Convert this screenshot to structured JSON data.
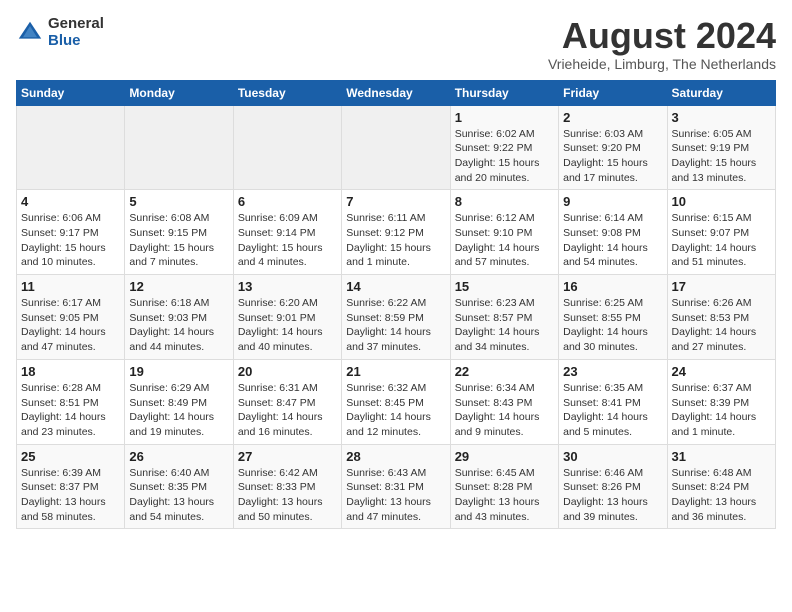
{
  "logo": {
    "general": "General",
    "blue": "Blue"
  },
  "title": "August 2024",
  "subtitle": "Vrieheide, Limburg, The Netherlands",
  "days_of_week": [
    "Sunday",
    "Monday",
    "Tuesday",
    "Wednesday",
    "Thursday",
    "Friday",
    "Saturday"
  ],
  "weeks": [
    [
      {
        "day": "",
        "info": ""
      },
      {
        "day": "",
        "info": ""
      },
      {
        "day": "",
        "info": ""
      },
      {
        "day": "",
        "info": ""
      },
      {
        "day": "1",
        "info": "Sunrise: 6:02 AM\nSunset: 9:22 PM\nDaylight: 15 hours\nand 20 minutes."
      },
      {
        "day": "2",
        "info": "Sunrise: 6:03 AM\nSunset: 9:20 PM\nDaylight: 15 hours\nand 17 minutes."
      },
      {
        "day": "3",
        "info": "Sunrise: 6:05 AM\nSunset: 9:19 PM\nDaylight: 15 hours\nand 13 minutes."
      }
    ],
    [
      {
        "day": "4",
        "info": "Sunrise: 6:06 AM\nSunset: 9:17 PM\nDaylight: 15 hours\nand 10 minutes."
      },
      {
        "day": "5",
        "info": "Sunrise: 6:08 AM\nSunset: 9:15 PM\nDaylight: 15 hours\nand 7 minutes."
      },
      {
        "day": "6",
        "info": "Sunrise: 6:09 AM\nSunset: 9:14 PM\nDaylight: 15 hours\nand 4 minutes."
      },
      {
        "day": "7",
        "info": "Sunrise: 6:11 AM\nSunset: 9:12 PM\nDaylight: 15 hours\nand 1 minute."
      },
      {
        "day": "8",
        "info": "Sunrise: 6:12 AM\nSunset: 9:10 PM\nDaylight: 14 hours\nand 57 minutes."
      },
      {
        "day": "9",
        "info": "Sunrise: 6:14 AM\nSunset: 9:08 PM\nDaylight: 14 hours\nand 54 minutes."
      },
      {
        "day": "10",
        "info": "Sunrise: 6:15 AM\nSunset: 9:07 PM\nDaylight: 14 hours\nand 51 minutes."
      }
    ],
    [
      {
        "day": "11",
        "info": "Sunrise: 6:17 AM\nSunset: 9:05 PM\nDaylight: 14 hours\nand 47 minutes."
      },
      {
        "day": "12",
        "info": "Sunrise: 6:18 AM\nSunset: 9:03 PM\nDaylight: 14 hours\nand 44 minutes."
      },
      {
        "day": "13",
        "info": "Sunrise: 6:20 AM\nSunset: 9:01 PM\nDaylight: 14 hours\nand 40 minutes."
      },
      {
        "day": "14",
        "info": "Sunrise: 6:22 AM\nSunset: 8:59 PM\nDaylight: 14 hours\nand 37 minutes."
      },
      {
        "day": "15",
        "info": "Sunrise: 6:23 AM\nSunset: 8:57 PM\nDaylight: 14 hours\nand 34 minutes."
      },
      {
        "day": "16",
        "info": "Sunrise: 6:25 AM\nSunset: 8:55 PM\nDaylight: 14 hours\nand 30 minutes."
      },
      {
        "day": "17",
        "info": "Sunrise: 6:26 AM\nSunset: 8:53 PM\nDaylight: 14 hours\nand 27 minutes."
      }
    ],
    [
      {
        "day": "18",
        "info": "Sunrise: 6:28 AM\nSunset: 8:51 PM\nDaylight: 14 hours\nand 23 minutes."
      },
      {
        "day": "19",
        "info": "Sunrise: 6:29 AM\nSunset: 8:49 PM\nDaylight: 14 hours\nand 19 minutes."
      },
      {
        "day": "20",
        "info": "Sunrise: 6:31 AM\nSunset: 8:47 PM\nDaylight: 14 hours\nand 16 minutes."
      },
      {
        "day": "21",
        "info": "Sunrise: 6:32 AM\nSunset: 8:45 PM\nDaylight: 14 hours\nand 12 minutes."
      },
      {
        "day": "22",
        "info": "Sunrise: 6:34 AM\nSunset: 8:43 PM\nDaylight: 14 hours\nand 9 minutes."
      },
      {
        "day": "23",
        "info": "Sunrise: 6:35 AM\nSunset: 8:41 PM\nDaylight: 14 hours\nand 5 minutes."
      },
      {
        "day": "24",
        "info": "Sunrise: 6:37 AM\nSunset: 8:39 PM\nDaylight: 14 hours\nand 1 minute."
      }
    ],
    [
      {
        "day": "25",
        "info": "Sunrise: 6:39 AM\nSunset: 8:37 PM\nDaylight: 13 hours\nand 58 minutes."
      },
      {
        "day": "26",
        "info": "Sunrise: 6:40 AM\nSunset: 8:35 PM\nDaylight: 13 hours\nand 54 minutes."
      },
      {
        "day": "27",
        "info": "Sunrise: 6:42 AM\nSunset: 8:33 PM\nDaylight: 13 hours\nand 50 minutes."
      },
      {
        "day": "28",
        "info": "Sunrise: 6:43 AM\nSunset: 8:31 PM\nDaylight: 13 hours\nand 47 minutes."
      },
      {
        "day": "29",
        "info": "Sunrise: 6:45 AM\nSunset: 8:28 PM\nDaylight: 13 hours\nand 43 minutes."
      },
      {
        "day": "30",
        "info": "Sunrise: 6:46 AM\nSunset: 8:26 PM\nDaylight: 13 hours\nand 39 minutes."
      },
      {
        "day": "31",
        "info": "Sunrise: 6:48 AM\nSunset: 8:24 PM\nDaylight: 13 hours\nand 36 minutes."
      }
    ]
  ]
}
